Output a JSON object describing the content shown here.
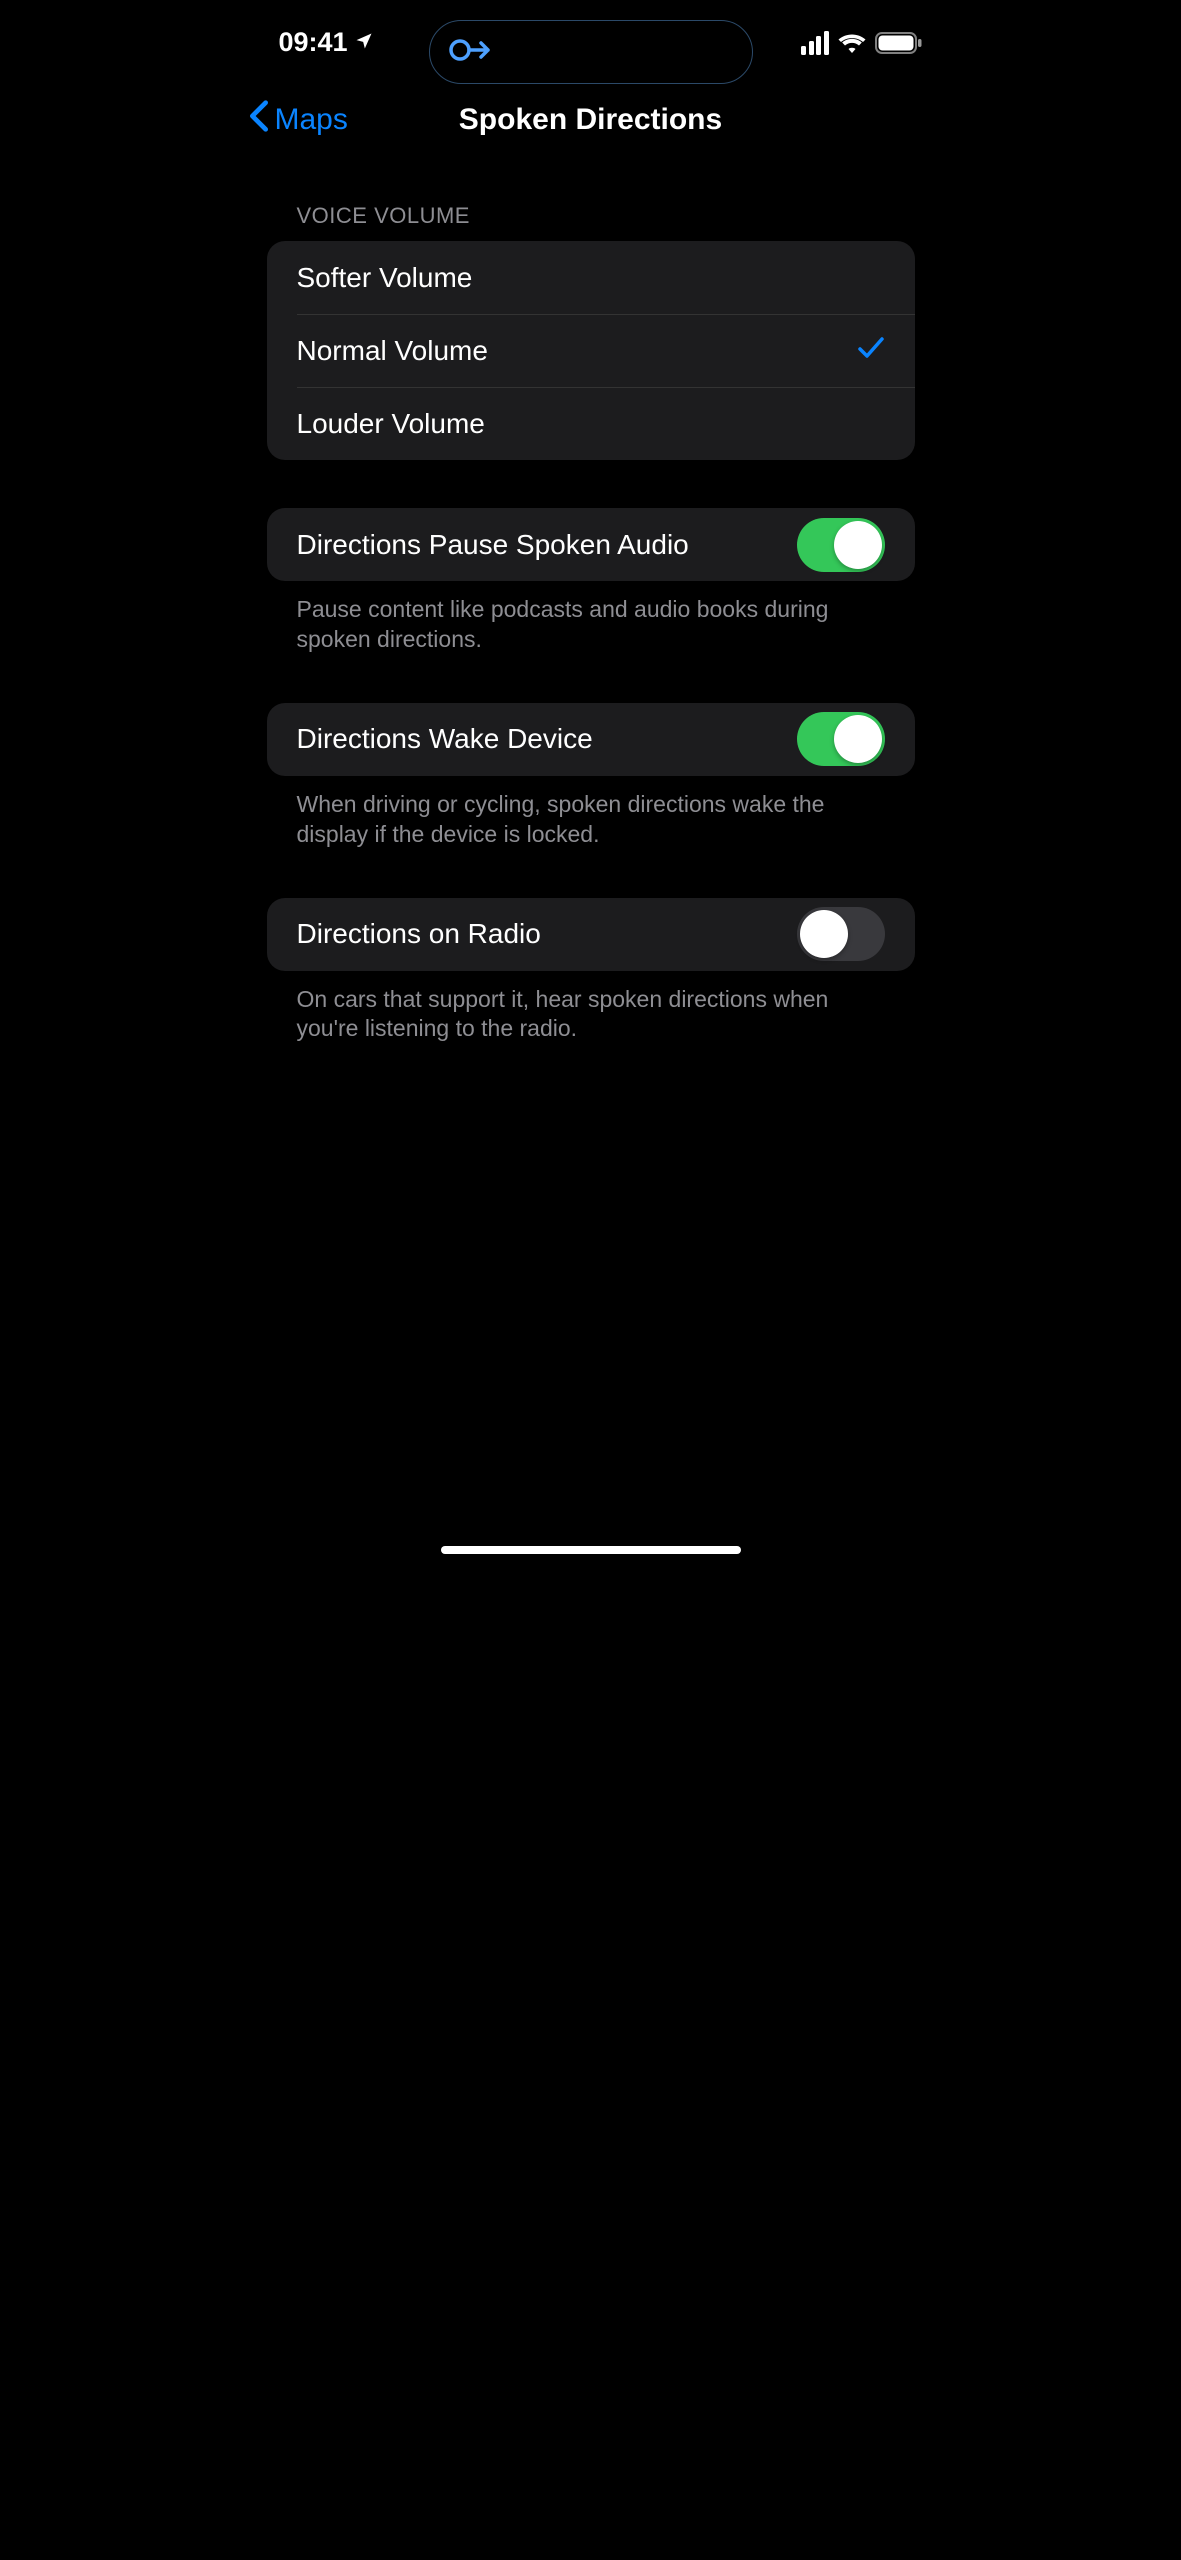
{
  "status": {
    "time": "09:41"
  },
  "nav": {
    "back_label": "Maps",
    "title": "Spoken Directions"
  },
  "sections": {
    "voice_volume": {
      "header": "Voice Volume",
      "options": [
        {
          "label": "Softer Volume",
          "checked": false
        },
        {
          "label": "Normal Volume",
          "checked": true
        },
        {
          "label": "Louder Volume",
          "checked": false
        }
      ]
    },
    "toggles": [
      {
        "label": "Directions Pause Spoken Audio",
        "footer": "Pause content like podcasts and audio books during spoken directions.",
        "on": true
      },
      {
        "label": "Directions Wake Device",
        "footer": "When driving or cycling, spoken directions wake the display if the device is locked.",
        "on": true
      },
      {
        "label": "Directions on Radio",
        "footer": "On cars that support it, hear spoken directions when you're listening to the radio.",
        "on": false
      }
    ]
  }
}
